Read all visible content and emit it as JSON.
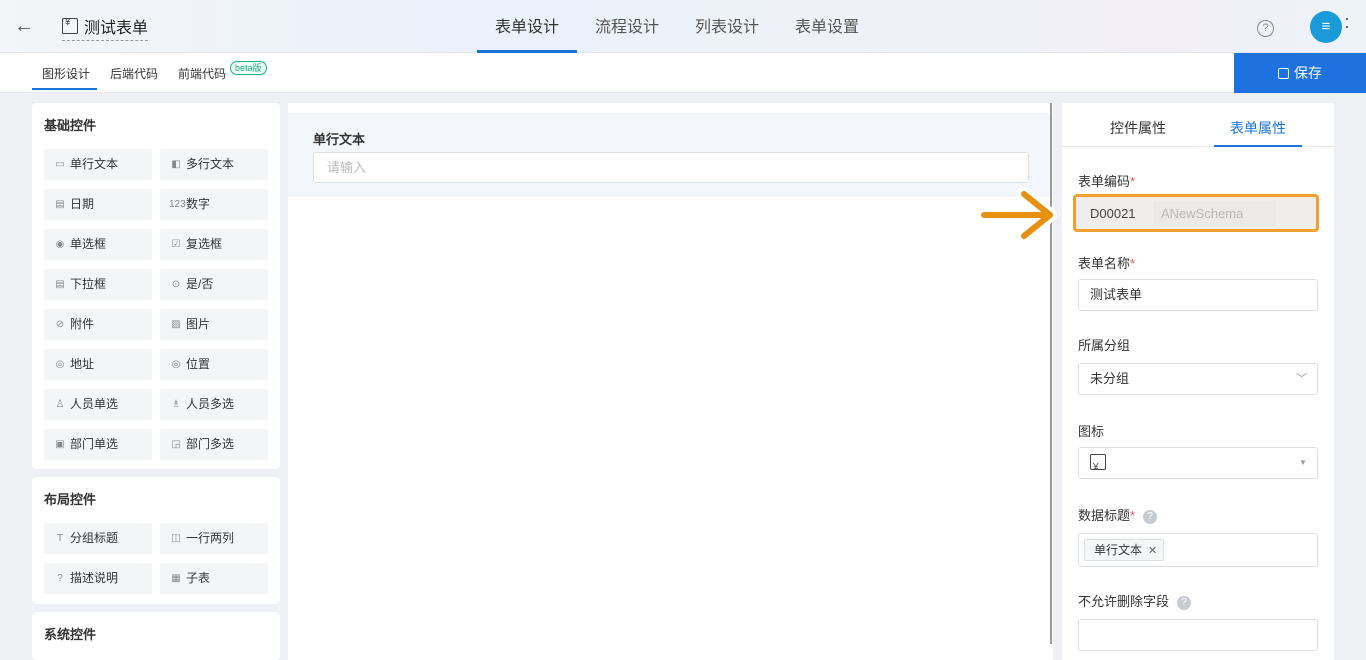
{
  "header": {
    "back_icon": "arrow-left-icon",
    "app_icon": "form-yen-icon",
    "title": "测试表单",
    "tabs": [
      {
        "label": "表单设计",
        "active": true
      },
      {
        "label": "流程设计",
        "active": false
      },
      {
        "label": "列表设计",
        "active": false
      },
      {
        "label": "表单设置",
        "active": false
      }
    ],
    "help_icon": "question-circle-icon",
    "avatar_icon": "user-avatar-icon"
  },
  "subtabs": {
    "items": [
      "图形设计",
      "后端代码",
      "前端代码"
    ],
    "beta_badge": "beta版",
    "save_label": "保存"
  },
  "left": {
    "basic_title": "基础控件",
    "basic": [
      {
        "label": "单行文本",
        "icon": "single-line-icon"
      },
      {
        "label": "多行文本",
        "icon": "multi-line-icon"
      },
      {
        "label": "日期",
        "icon": "calendar-icon"
      },
      {
        "label": "数字",
        "icon": "number-icon"
      },
      {
        "label": "单选框",
        "icon": "radio-icon"
      },
      {
        "label": "复选框",
        "icon": "checkbox-icon"
      },
      {
        "label": "下拉框",
        "icon": "dropdown-icon"
      },
      {
        "label": "是/否",
        "icon": "toggle-icon"
      },
      {
        "label": "附件",
        "icon": "paperclip-icon"
      },
      {
        "label": "图片",
        "icon": "image-icon"
      },
      {
        "label": "地址",
        "icon": "map-pin-icon"
      },
      {
        "label": "位置",
        "icon": "location-icon"
      },
      {
        "label": "人员单选",
        "icon": "user-icon"
      },
      {
        "label": "人员多选",
        "icon": "users-icon"
      },
      {
        "label": "部门单选",
        "icon": "dept-icon"
      },
      {
        "label": "部门多选",
        "icon": "depts-icon"
      }
    ],
    "layout_title": "布局控件",
    "layout": [
      {
        "label": "分组标题",
        "icon": "text-t-icon"
      },
      {
        "label": "一行两列",
        "icon": "columns-icon"
      },
      {
        "label": "描述说明",
        "icon": "question-circle-icon"
      },
      {
        "label": "子表",
        "icon": "table-icon"
      }
    ],
    "system_title": "系统控件"
  },
  "canvas": {
    "field_label": "单行文本",
    "field_placeholder": "请输入"
  },
  "right": {
    "tabs": [
      {
        "label": "控件属性",
        "active": false
      },
      {
        "label": "表单属性",
        "active": true
      }
    ],
    "code_label": "表单编码",
    "code_value": "D00021",
    "code_placeholder": "ANewSchema",
    "name_label": "表单名称",
    "name_value": "测试表单",
    "group_label": "所属分组",
    "group_value": "未分组",
    "icon_label": "图标",
    "data_title_label": "数据标题",
    "data_title_tag": "单行文本",
    "no_delete_label": "不允许删除字段",
    "required_mark": "*",
    "help_mark": "?"
  },
  "colors": {
    "accent": "#1a73d8",
    "save": "#1d72e0",
    "highlight": "#f0a030",
    "arrow": "#e8900f"
  }
}
